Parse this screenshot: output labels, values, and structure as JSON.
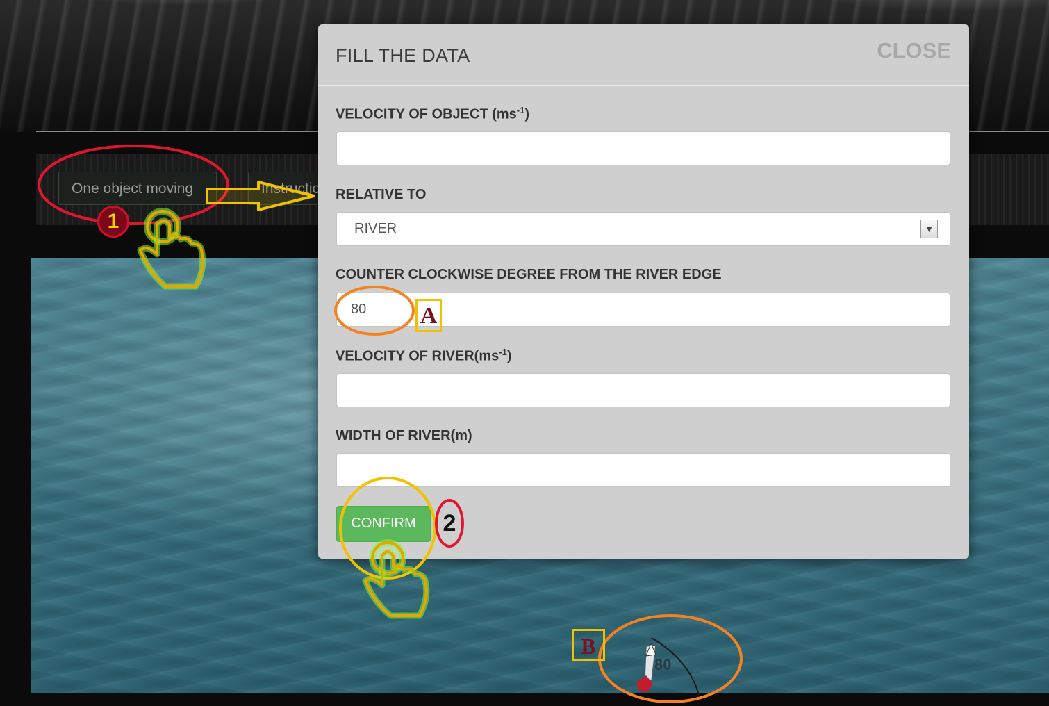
{
  "background": {
    "nav": {
      "one_object_label": "One object moving",
      "instructions_label": "Instructio"
    },
    "boat_angle_label": "80"
  },
  "modal": {
    "title": "FILL THE DATA",
    "close_label": "CLOSE",
    "fields": {
      "velocity_object_label": "VELOCITY OF OBJECT (ms",
      "velocity_object_unit_sup": "-1",
      "velocity_object_label_end": ")",
      "velocity_object_value": "",
      "relative_to_label": "RELATIVE TO",
      "relative_to_value": "RIVER",
      "degree_label": "COUNTER CLOCKWISE DEGREE FROM THE RIVER EDGE",
      "degree_value": "80",
      "velocity_river_label": "VELOCITY OF RIVER(ms",
      "velocity_river_unit_sup": "-1",
      "velocity_river_label_end": ")",
      "velocity_river_value": "",
      "width_river_label": "WIDTH OF RIVER(m)",
      "width_river_value": ""
    },
    "confirm_label": "CONFIRM"
  },
  "annotations": {
    "step_1": "1",
    "step_2": "2",
    "tag_a": "A",
    "tag_b": "B"
  },
  "colors": {
    "confirm_green": "#5cb85c",
    "highlight_red": "#e0162e",
    "highlight_yellow": "#f2c200",
    "highlight_orange": "#f58220"
  },
  "icons": [
    "pointing-hand-icon",
    "right-arrow-icon",
    "chevron-down-icon",
    "boat-icon"
  ]
}
